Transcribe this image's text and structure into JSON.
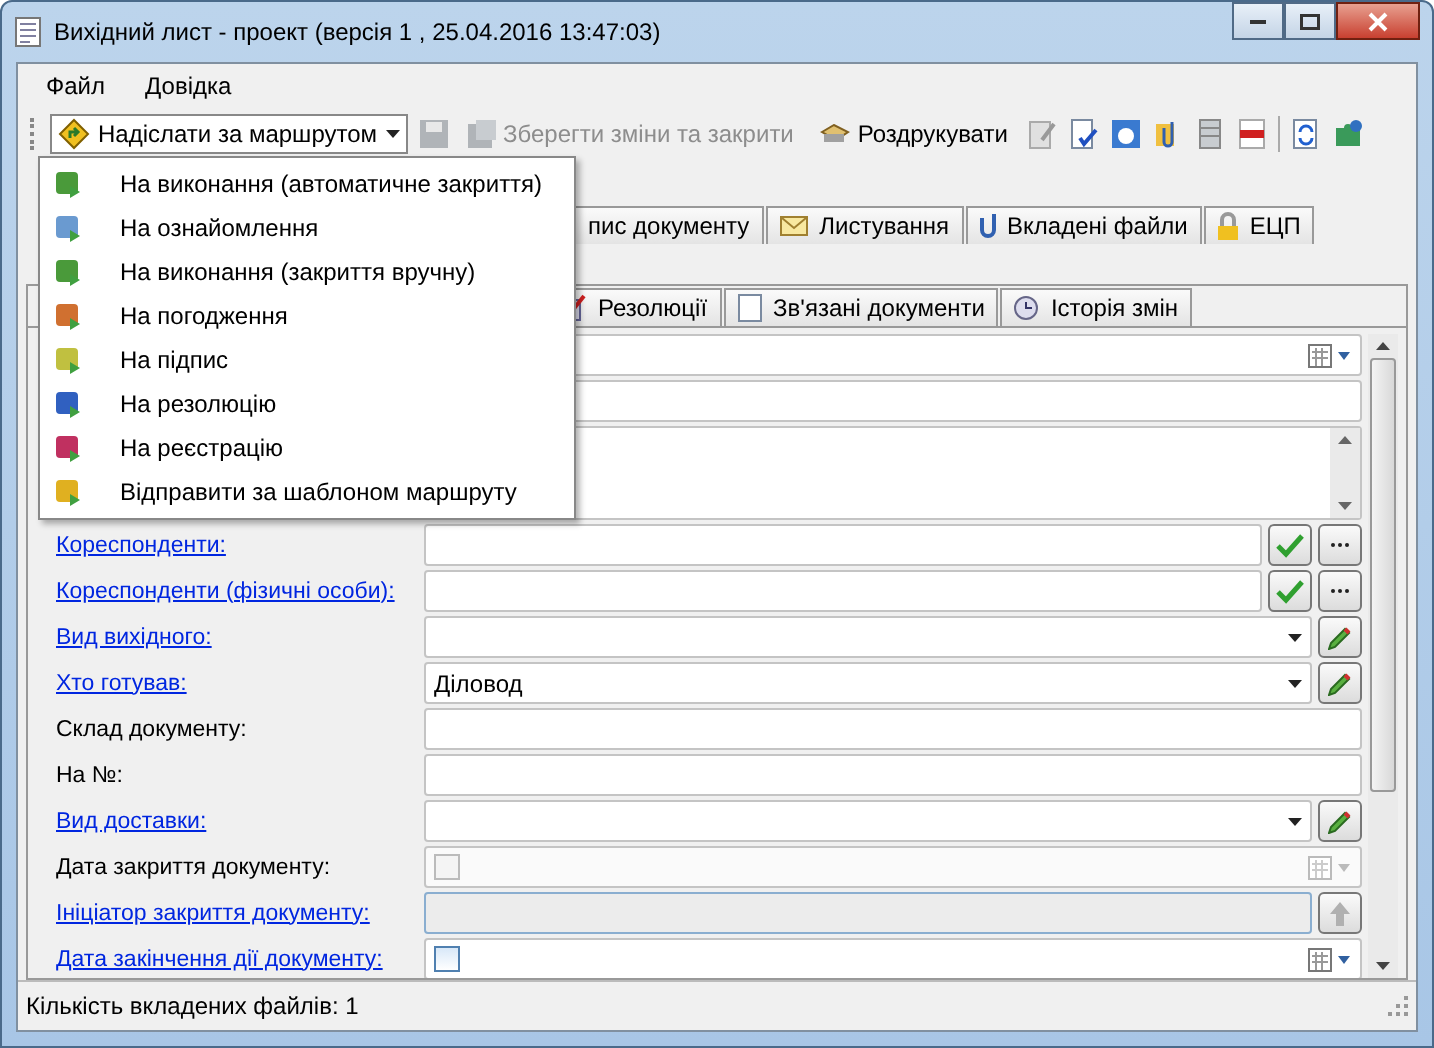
{
  "window": {
    "title": "Вихідний лист - проект (версія 1 , 25.04.2016 13:47:03)"
  },
  "menu_bar": [
    "Файл",
    "Довідка"
  ],
  "toolbar": {
    "send_button": {
      "label": "Надіслати за маршрутом",
      "pressed": true
    },
    "save_close": {
      "label": "Зберегти зміни та закрити",
      "disabled": true
    },
    "print": {
      "label": "Роздрукувати",
      "disabled": false
    }
  },
  "send_menu": [
    {
      "label": "На виконання (автоматичне закриття)"
    },
    {
      "label": "На ознайомлення"
    },
    {
      "label": "На виконання (закриття вручну)"
    },
    {
      "label": "На погодження"
    },
    {
      "label": "На підпис"
    },
    {
      "label": "На резолюцію"
    },
    {
      "label": "На реєстрацію"
    },
    {
      "label": "Відправити за шаблоном маршруту"
    }
  ],
  "tabs_row_1": [
    {
      "label": "пис документу",
      "selected": false
    },
    {
      "label": "Листування",
      "selected": false
    },
    {
      "label": "Вкладені файли",
      "selected": false
    },
    {
      "label": "ЕЦП",
      "selected": false
    }
  ],
  "tabs_row_2": [
    {
      "label": "Резолюції",
      "selected": false
    },
    {
      "label": "Зв'язані документи",
      "selected": false
    },
    {
      "label": "Історія змін",
      "selected": false
    }
  ],
  "fields": [
    {
      "label": "Кореспонденти:",
      "link": true,
      "kind": "lookup"
    },
    {
      "label": "Кореспонденти (фізичні особи):",
      "link": true,
      "kind": "lookup"
    },
    {
      "label": "Вид вихідного:",
      "link": true,
      "kind": "combo"
    },
    {
      "label": "Хто готував:",
      "link": true,
      "kind": "combo",
      "value": "Діловод"
    },
    {
      "label": "Склад документу:",
      "link": false,
      "kind": "text"
    },
    {
      "label": "На №:",
      "link": false,
      "kind": "text"
    },
    {
      "label": "Вид доставки:",
      "link": true,
      "kind": "combo"
    },
    {
      "label": "Дата закриття документу:",
      "link": false,
      "kind": "date",
      "checked": false,
      "disabled": true
    },
    {
      "label": "Ініціатор закриття документу:",
      "link": true,
      "kind": "readonly"
    },
    {
      "label": "Дата закінчення дії документу:",
      "link": true,
      "kind": "date",
      "checked": false,
      "disabled": false
    }
  ],
  "status_bar": "Кількість вкладених файлів: 1"
}
